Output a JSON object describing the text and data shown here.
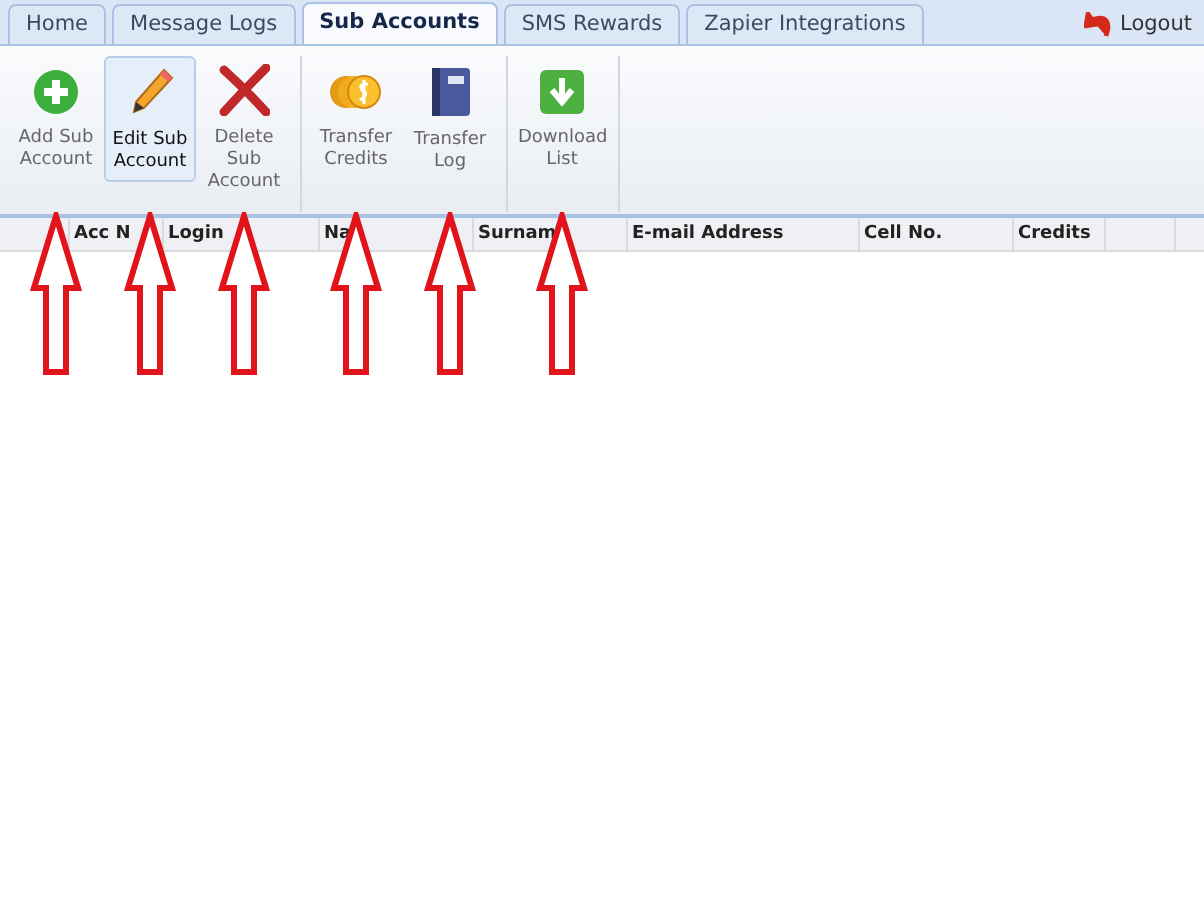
{
  "tabs": [
    {
      "label": "Home",
      "selected": false
    },
    {
      "label": "Message Logs",
      "selected": false
    },
    {
      "label": "Sub Accounts",
      "selected": true
    },
    {
      "label": "SMS Rewards",
      "selected": false
    },
    {
      "label": "Zapier Integrations",
      "selected": false
    }
  ],
  "logout": {
    "label": "Logout"
  },
  "toolbar": {
    "groups": [
      {
        "buttons": [
          {
            "kind": "add",
            "label": "Add Sub Account",
            "selected": false,
            "pointed_at": true
          },
          {
            "kind": "edit",
            "label": "Edit Sub Account",
            "selected": true,
            "pointed_at": true
          },
          {
            "kind": "delete",
            "label": "Delete Sub Account",
            "selected": false,
            "pointed_at": true
          }
        ]
      },
      {
        "buttons": [
          {
            "kind": "coins",
            "label": "Transfer Credits",
            "selected": false,
            "pointed_at": true
          },
          {
            "kind": "book",
            "label": "Transfer Log",
            "selected": false,
            "pointed_at": true
          }
        ]
      },
      {
        "buttons": [
          {
            "kind": "download",
            "label": "Download List",
            "selected": false,
            "pointed_at": true
          }
        ]
      }
    ]
  },
  "table": {
    "columns": [
      "",
      "Acc N",
      "Login",
      "Na",
      "Surnam",
      "E-mail Address",
      "Cell No.",
      "Credits",
      ""
    ]
  }
}
